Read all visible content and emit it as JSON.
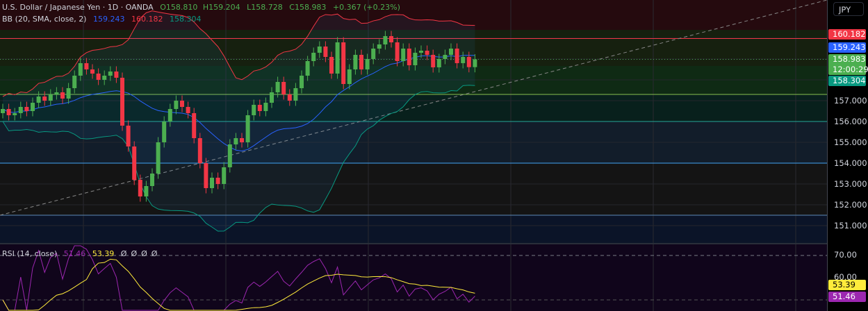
{
  "header": {
    "symbol": "U.S. Dollar / Japanese Yen · 1D · OANDA",
    "open": "O158.810",
    "high": "H159.204",
    "low": "L158.728",
    "close": "C158.983",
    "change": "+0.367 (+0.23%)"
  },
  "bb_legend": {
    "label": "BB (20, SMA, close, 2)",
    "basis": "159.243",
    "upper": "160.182",
    "lower": "158.304"
  },
  "rsi_legend": {
    "label": "RSI (14, close)",
    "rsi": "51.46",
    "ma": "53.39",
    "extras": [
      "Ø",
      "Ø",
      "Ø",
      "Ø"
    ]
  },
  "axis": {
    "currency": "JPY",
    "price_ticks": [
      "157.000",
      "156.000",
      "155.000",
      "154.000",
      "153.000",
      "152.000",
      "151.000"
    ],
    "rsi_ticks": [
      "70.00",
      "60.00"
    ],
    "labels": {
      "upper": "160.182",
      "basis": "159.243",
      "last": "158.983",
      "countdown": "12:00:29",
      "lower": "158.304",
      "rsi_ma": "53.39",
      "rsi": "51.46"
    }
  },
  "colors": {
    "up": "#26a69a",
    "up_alt": "#4caf50",
    "down": "#f23645",
    "basis": "#2962ff",
    "upper": "#f23645",
    "lower": "#089981",
    "rsi": "#9c27b0",
    "rsi_ma": "#ffeb3b"
  },
  "chart_data": {
    "type": "candlestick",
    "title": "U.S. Dollar / Japanese Yen · 1D · OANDA",
    "ylim": [
      150.2,
      162.5
    ],
    "closes": [
      156.6,
      156.3,
      156.4,
      156.7,
      156.5,
      156.9,
      157.2,
      157.0,
      157.3,
      157.4,
      157.1,
      157.6,
      158.2,
      158.8,
      158.5,
      158.3,
      158.0,
      158.2,
      158.4,
      158.1,
      155.8,
      154.8,
      153.2,
      152.4,
      152.9,
      153.5,
      155.0,
      156.0,
      156.6,
      157.0,
      156.7,
      156.4,
      155.2,
      154.0,
      152.8,
      153.3,
      153.0,
      153.8,
      154.9,
      155.2,
      155.0,
      156.3,
      156.8,
      156.5,
      156.9,
      157.4,
      157.9,
      157.3,
      157.0,
      157.6,
      158.2,
      158.9,
      159.3,
      159.6,
      159.1,
      158.3,
      159.8,
      157.8,
      158.5,
      159.2,
      158.5,
      159.0,
      159.5,
      159.7,
      160.1,
      159.8,
      158.9,
      159.5,
      158.7,
      159.3,
      159.4,
      159.2,
      158.6,
      159.0,
      159.2,
      159.5,
      158.8,
      159.1,
      158.61,
      158.983
    ],
    "indicators": [
      "Bollinger Bands (20, SMA, close, 2)",
      "RSI (14, close)"
    ],
    "horizontal_levels": [
      160.182,
      157.3,
      156.0,
      154.0,
      151.5
    ]
  }
}
